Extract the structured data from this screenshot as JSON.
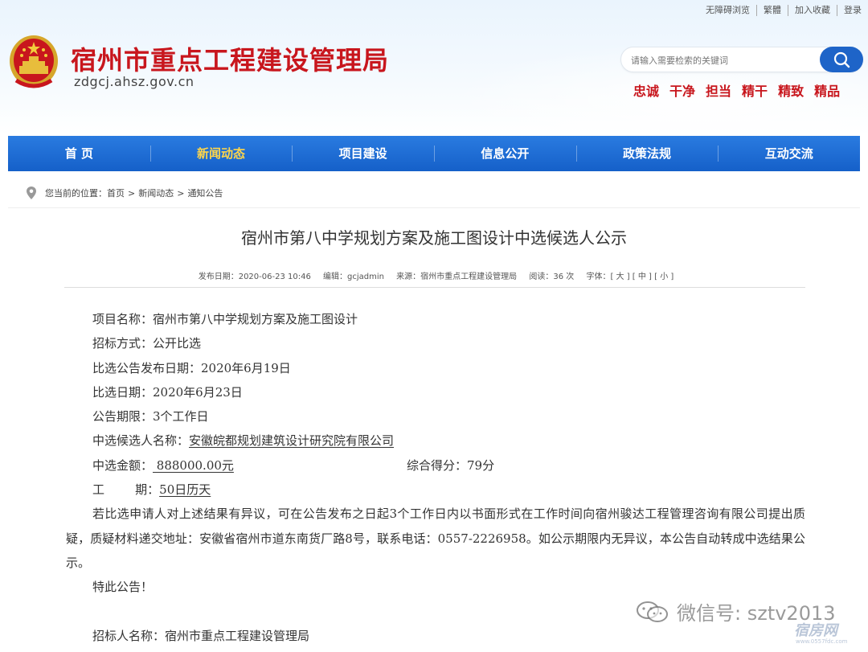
{
  "header": {
    "site_title": "宿州市重点工程建设管理局",
    "site_domain": "zdgcj.ahsz.gov.cn",
    "top_links": [
      "无障碍浏览",
      "繁體",
      "加入收藏",
      "登录"
    ],
    "search_placeholder": "请输入需要检索的关键词",
    "slogans": [
      "忠诚",
      "干净",
      "担当",
      "精干",
      "精致",
      "精品"
    ]
  },
  "nav": {
    "items": [
      {
        "label": "首 页",
        "active": false
      },
      {
        "label": "新闻动态",
        "active": true
      },
      {
        "label": "项目建设",
        "active": false
      },
      {
        "label": "信息公开",
        "active": false
      },
      {
        "label": "政策法规",
        "active": false
      },
      {
        "label": "互动交流",
        "active": false
      }
    ]
  },
  "breadcrumb": {
    "prefix": "您当前的位置：",
    "items": [
      "首页",
      "新闻动态",
      "通知公告"
    ],
    "separator": ">"
  },
  "article": {
    "title": "宿州市第八中学规划方案及施工图设计中选候选人公示",
    "meta": {
      "date": "发布日期：2020-06-23 10:46",
      "editor": "编辑：gcjadmin",
      "source": "来源：宿州市重点工程建设管理局",
      "views": "阅读：36 次",
      "font_size": "字体：[ 大 ] [ 中 ] [ 小 ]"
    },
    "lines": {
      "project_name": "项目名称：宿州市第八中学规划方案及施工图设计",
      "method": "招标方式：公开比选",
      "notice_date": "比选公告发布日期：2020年6月19日",
      "select_date": "比选日期：2020年6月23日",
      "period": "公告期限：3个工作日",
      "candidate_label": "中选候选人名称：",
      "candidate_value": "安徽皖都规划建筑设计研究院有限公司",
      "amount_label": "中选金额：",
      "amount_value": " 888000.00元",
      "score": "综合得分：79分",
      "duration_label": "工        期：",
      "duration_value": "50日历天",
      "objection": "若比选申请人对上述结果有异议，可在公告发布之日起3个工作日内以书面形式在工作时间向宿州骏达工程管理咨询有限公司提出质疑，质疑材料递交地址：安徽省宿州市道东南货厂路8号，联系电话：0557-2226958。如公示期限内无异议，本公告自动转成中选结果公示。",
      "closing": "特此公告！",
      "tenderer": "招标人名称：宿州市重点工程建设管理局"
    }
  },
  "watermark": {
    "wechat": "微信号: sztv2013",
    "brand": "宿房网",
    "brand_url": "www.0557fdc.com"
  },
  "colors": {
    "brand_red": "#c8161d",
    "nav_blue": "#1e64c8",
    "nav_active": "#ffd64a"
  }
}
